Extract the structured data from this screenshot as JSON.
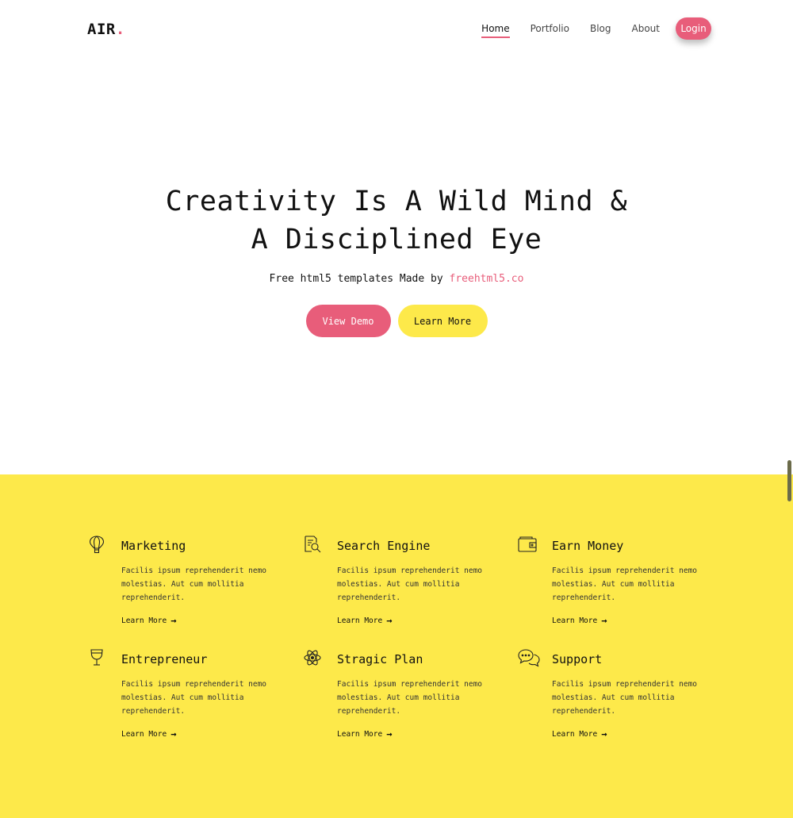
{
  "logo": {
    "text": "AIR",
    "dot": "."
  },
  "nav": {
    "items": [
      {
        "label": "Home"
      },
      {
        "label": "Portfolio"
      },
      {
        "label": "Blog"
      },
      {
        "label": "About"
      }
    ],
    "login": "Login"
  },
  "hero": {
    "title_line1": "Creativity Is A Wild Mind &",
    "title_line2": "A Disciplined Eye",
    "subtitle": "Free html5 templates Made by",
    "subtitle_link": "freehtml5.co",
    "primary_button": "View Demo",
    "secondary_button": "Learn More"
  },
  "features": [
    {
      "icon": "hot-air-balloon-icon",
      "title": "Marketing",
      "text": "Facilis ipsum reprehenderit nemo molestias. Aut cum mollitia reprehenderit.",
      "link": "Learn More"
    },
    {
      "icon": "search-document-icon",
      "title": "Search Engine",
      "text": "Facilis ipsum reprehenderit nemo molestias. Aut cum mollitia reprehenderit.",
      "link": "Learn More"
    },
    {
      "icon": "wallet-icon",
      "title": "Earn Money",
      "text": "Facilis ipsum reprehenderit nemo molestias. Aut cum mollitia reprehenderit.",
      "link": "Learn More"
    },
    {
      "icon": "wine-glass-icon",
      "title": "Entrepreneur",
      "text": "Facilis ipsum reprehenderit nemo molestias. Aut cum mollitia reprehenderit.",
      "link": "Learn More"
    },
    {
      "icon": "atom-icon",
      "title": "Stragic Plan",
      "text": "Facilis ipsum reprehenderit nemo molestias. Aut cum mollitia reprehenderit.",
      "link": "Learn More"
    },
    {
      "icon": "chat-bubbles-icon",
      "title": "Support",
      "text": "Facilis ipsum reprehenderit nemo molestias. Aut cum mollitia reprehenderit.",
      "link": "Learn More"
    }
  ],
  "colors": {
    "accent_pink": "#e85d7a",
    "accent_yellow": "#fde94a"
  }
}
